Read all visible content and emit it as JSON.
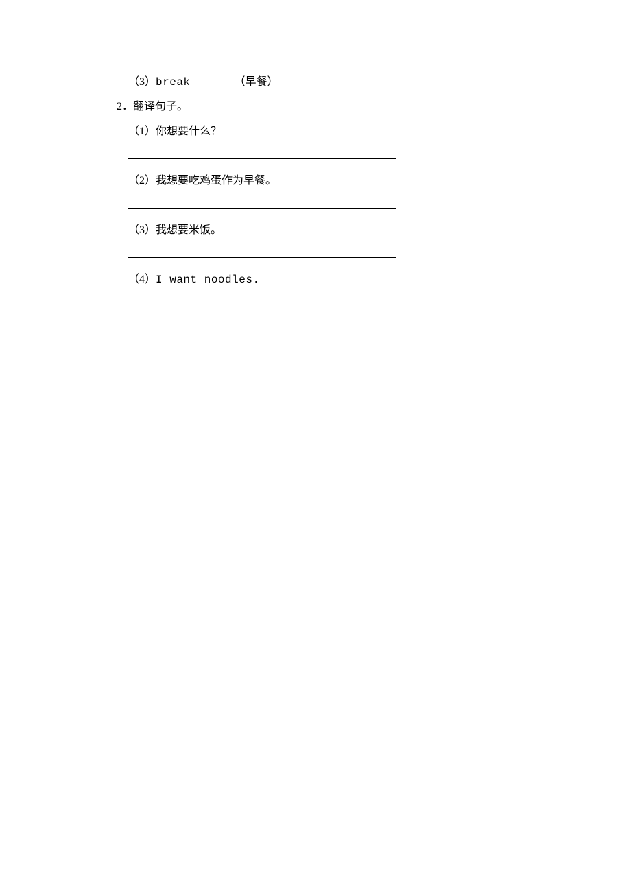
{
  "q1": {
    "item3": {
      "label": "（3）",
      "word_prefix": "break",
      "hint": "（早餐）"
    }
  },
  "q2": {
    "heading": "2．翻译句子。",
    "items": [
      {
        "label": "（1）",
        "text": "你想要什么？"
      },
      {
        "label": "（2）",
        "text": "我想要吃鸡蛋作为早餐。"
      },
      {
        "label": "（3）",
        "text": "我想要米饭。"
      },
      {
        "label": "（4）",
        "text": "I want noodles."
      }
    ]
  }
}
